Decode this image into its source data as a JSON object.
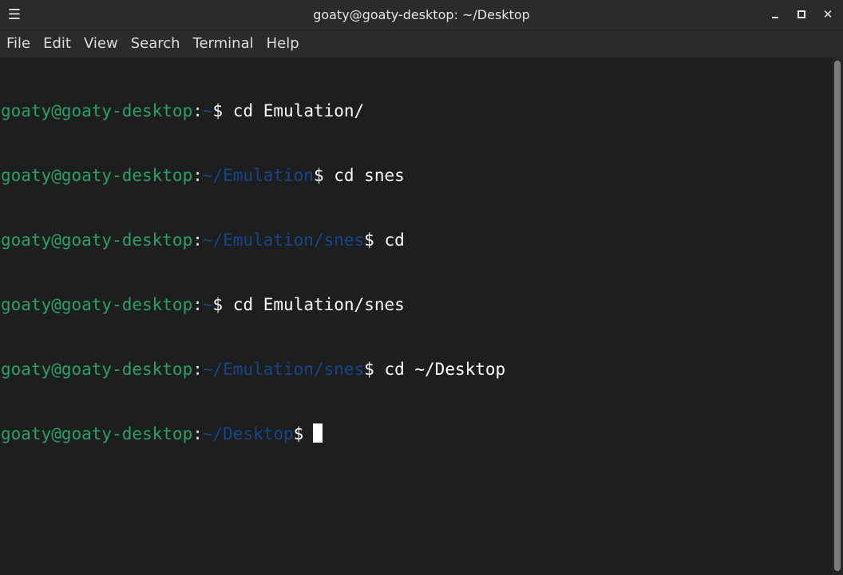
{
  "window": {
    "title": "goaty@goaty-desktop: ~/Desktop",
    "menu_glyph": "☰",
    "close_glyph": "✕"
  },
  "menubar": {
    "items": [
      "File",
      "Edit",
      "View",
      "Search",
      "Terminal",
      "Help"
    ]
  },
  "terminal": {
    "lines": [
      {
        "user": "goaty@goaty-desktop",
        "sep": ":",
        "path": "~",
        "dollar": "$",
        "cmd": " cd Emulation/"
      },
      {
        "user": "goaty@goaty-desktop",
        "sep": ":",
        "path": "~/Emulation",
        "dollar": "$",
        "cmd": " cd snes"
      },
      {
        "user": "goaty@goaty-desktop",
        "sep": ":",
        "path": "~/Emulation/snes",
        "dollar": "$",
        "cmd": " cd"
      },
      {
        "user": "goaty@goaty-desktop",
        "sep": ":",
        "path": "~",
        "dollar": "$",
        "cmd": " cd Emulation/snes"
      },
      {
        "user": "goaty@goaty-desktop",
        "sep": ":",
        "path": "~/Emulation/snes",
        "dollar": "$",
        "cmd": " cd ~/Desktop"
      },
      {
        "user": "goaty@goaty-desktop",
        "sep": ":",
        "path": "~/Desktop",
        "dollar": "$",
        "cmd": ""
      }
    ]
  },
  "colors": {
    "user": "#26a269",
    "path": "#12488b",
    "background": "#1e1e1e",
    "chrome": "#2b2b2b"
  }
}
